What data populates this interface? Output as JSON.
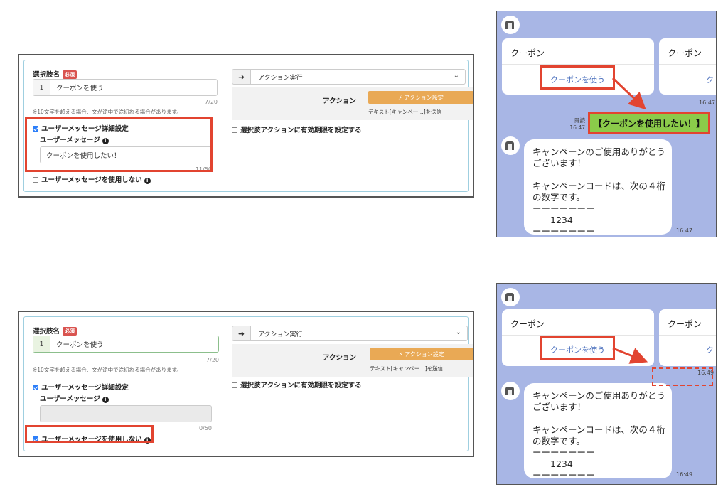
{
  "top_panel": {
    "choice_label": "選択肢名",
    "required_badge": "必須",
    "choice_number": "1",
    "choice_value": "クーポンを使う",
    "choice_counter": "7/20",
    "note": "※10文字を超える場合、文が途中で途切れる場合があります。",
    "detail_checkbox_label": "ユーザーメッセージ詳細設定",
    "detail_checked": true,
    "user_message_label": "ユーザーメッセージ",
    "user_message_value": "クーポンを使用したい！",
    "user_message_counter": "11/50",
    "no_message_label": "ユーザーメッセージを使用しない",
    "no_message_checked": false,
    "arrow_icon": "arrow-right-icon",
    "action_select": "アクション実行",
    "action_label": "アクション",
    "action_button": "⚡ アクション設定",
    "action_desc": "テキスト[キャンペー…]を送信",
    "expiry_label": "選択肢アクションに有効期限を設定する"
  },
  "bottom_panel": {
    "choice_label": "選択肢名",
    "required_badge": "必須",
    "choice_number": "1",
    "choice_value": "クーポンを使う",
    "choice_counter": "7/20",
    "note": "※10文字を超える場合、文が途中で途切れる場合があります。",
    "detail_checkbox_label": "ユーザーメッセージ詳細設定",
    "detail_checked": true,
    "user_message_label": "ユーザーメッセージ",
    "user_message_value": "",
    "user_message_counter": "0/50",
    "no_message_label": "ユーザーメッセージを使用しない",
    "no_message_checked": true,
    "arrow_icon": "arrow-right-icon",
    "action_select": "アクション実行",
    "action_label": "アクション",
    "action_button": "⚡ アクション設定",
    "action_desc": "テキスト[キャンペー…]を送信",
    "expiry_label": "選択肢アクションに有効期限を設定する"
  },
  "top_chat": {
    "card1_title": "クーポン",
    "card1_link": "クーポンを使う",
    "card2_title": "クーポン",
    "card2_link": "ク",
    "card_time": "16:47",
    "read_label": "既読",
    "sent_time": "16:47",
    "sent_message": "【クーポンを使用したい！】",
    "reply": "キャンペーンのご使用ありがとう\nございます！\n\nキャンペーンコードは、次の４桁\nの数字です。\nーーーーーーー\n　　1234\nーーーーーーー",
    "reply_time": "16:47"
  },
  "bottom_chat": {
    "card1_title": "クーポン",
    "card1_link": "クーポンを使う",
    "card2_title": "クーポン",
    "card2_link": "ク",
    "card_time": "16:49",
    "reply": "キャンペーンのご使用ありがとう\nございます！\n\nキャンペーンコードは、次の４桁\nの数字です。\nーーーーーーー\n　　1234\nーーーーーーー",
    "reply_time": "16:49"
  },
  "colors": {
    "highlight_red": "#e24430",
    "chat_background": "#a8b6e5",
    "sent_bubble": "#8bcb4a",
    "action_button": "#e9a955"
  }
}
